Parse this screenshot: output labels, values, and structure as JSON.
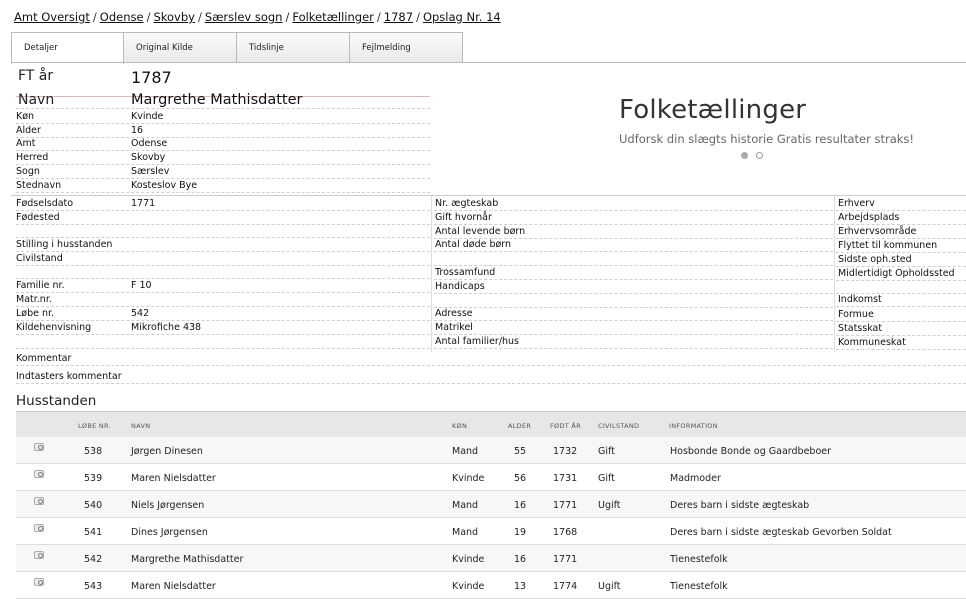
{
  "breadcrumb": [
    "Amt Oversigt",
    "Odense",
    "Skovby",
    "Særslev sogn",
    "Folketællinger",
    "1787",
    "Opslag Nr. 14"
  ],
  "tabs": [
    "Detaljer",
    "Original Kilde",
    "Tidslinje",
    "Fejlmelding"
  ],
  "header": {
    "ft_label": "FT år",
    "ft_value": "1787",
    "navn_label": "Navn",
    "navn_value": "Margrethe Mathisdatter"
  },
  "fields_top": [
    {
      "label": "Køn",
      "value": "Kvinde"
    },
    {
      "label": "Alder",
      "value": "16"
    },
    {
      "label": "Amt",
      "value": "Odense"
    },
    {
      "label": "Herred",
      "value": "Skovby"
    },
    {
      "label": "Sogn",
      "value": "Særslev"
    },
    {
      "label": "Stednavn",
      "value": "Kosteslov Bye"
    }
  ],
  "ad": {
    "title": "Folketællinger",
    "subtitle": "Udforsk din slægts historie Gratis resultater straks!"
  },
  "col1": [
    {
      "label": "Fødselsdato",
      "value": "1771"
    },
    {
      "label": "Fødested",
      "value": ""
    },
    {
      "label": "Stilling i husstanden",
      "value": ""
    },
    {
      "label": "Civilstand",
      "value": ""
    },
    {
      "label": "Familie nr.",
      "value": "F 10"
    },
    {
      "label": "Matr.nr.",
      "value": ""
    },
    {
      "label": "Løbe nr.",
      "value": "542"
    },
    {
      "label": "Kildehenvisning",
      "value": "Mikrofiche 438"
    }
  ],
  "col2": [
    "Nr. ægteskab",
    "Gift hvornår",
    "Antal levende børn",
    "Antal døde børn",
    "Trossamfund",
    "Handicaps",
    "Adresse",
    "Matrikel",
    "Antal familier/hus"
  ],
  "col3": [
    "Erhverv",
    "Arbejdsplads",
    "Erhvervsområde",
    "Flyttet til kommunen",
    "Sidste oph.sted",
    "Midlertidigt Opholdssted",
    "Indkomst",
    "Formue",
    "Statsskat",
    "Kommuneskat"
  ],
  "comments": {
    "kommentar": "Kommentar",
    "indtaster": "Indtasters kommentar"
  },
  "household": {
    "title": "Husstanden",
    "headers": [
      "LØBE NR.",
      "NAVN",
      "KØN",
      "ALDER",
      "FØDT ÅR",
      "CIVILSTAND",
      "INFORMATION"
    ],
    "rows": [
      [
        "538",
        "Jørgen Dinesen",
        "Mand",
        "55",
        "1732",
        "Gift",
        "Hosbonde Bonde og Gaardbeboer"
      ],
      [
        "539",
        "Maren Nielsdatter",
        "Kvinde",
        "56",
        "1731",
        "Gift",
        "Madmoder"
      ],
      [
        "540",
        "Niels Jørgensen",
        "Mand",
        "16",
        "1771",
        "Ugift",
        "Deres barn i sidste ægteskab"
      ],
      [
        "541",
        "Dines Jørgensen",
        "Mand",
        "19",
        "1768",
        "",
        "Deres barn i sidste ægteskab Gevorben Soldat"
      ],
      [
        "542",
        "Margrethe Mathisdatter",
        "Kvinde",
        "16",
        "1771",
        "",
        "Tienestefolk"
      ],
      [
        "543",
        "Maren Nielsdatter",
        "Kvinde",
        "13",
        "1774",
        "Ugift",
        "Tienestefolk"
      ]
    ]
  }
}
